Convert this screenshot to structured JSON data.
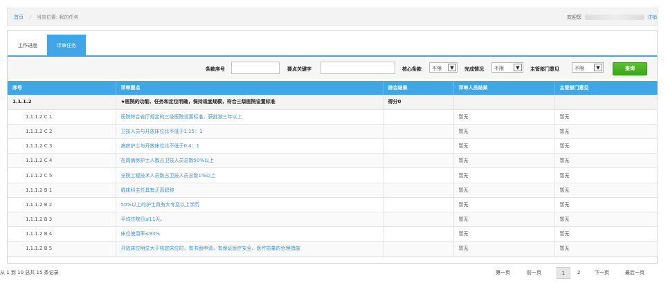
{
  "breadcrumb": {
    "home": "首页",
    "separator": "/",
    "location": "当前位置: 我的任务"
  },
  "user": {
    "welcome": "欢迎您",
    "logout": "注销"
  },
  "tabs": [
    {
      "label": "工作进度"
    },
    {
      "label": "评审任务"
    }
  ],
  "filters": {
    "item_no_label": "条款序号",
    "item_no_value": "",
    "keyword_label": "要点关键字",
    "keyword_value": "",
    "core_label": "核心条款",
    "core_value": "不限",
    "completion_label": "完成情况",
    "completion_value": "不限",
    "dept_label": "主管部门意见",
    "dept_value": "不限",
    "query_button": "查询"
  },
  "table": {
    "headers": [
      "序号",
      "评审要点",
      "综合结果",
      "评审人员结果",
      "主管部门意见"
    ],
    "group_row": {
      "code": "1.1.1.2",
      "point": "★医院的功能、任务和定位明确，保持适度规模，符合三级医院设置标准",
      "result": "得分0",
      "reviewer": "",
      "dept": ""
    },
    "rows": [
      {
        "code": "1.1.1.2 C 1",
        "point": "医院符合省厅规定的三级医院设置标准，获批准三年以上",
        "result": "",
        "reviewer": "暂无",
        "dept": "暂无"
      },
      {
        "code": "1.1.1.2 C 2",
        "point": "卫技人员与开放床位比不低于1.15：1",
        "result": "",
        "reviewer": "暂无",
        "dept": "暂无"
      },
      {
        "code": "1.1.1.2 C 3",
        "point": "病房护士与开放床位比不低于0.4：1",
        "result": "",
        "reviewer": "暂无",
        "dept": "暂无"
      },
      {
        "code": "1.1.1.2 C 4",
        "point": "在岗病房护士人数占卫技人员总数50%以上",
        "result": "",
        "reviewer": "暂无",
        "dept": "暂无"
      },
      {
        "code": "1.1.1.2 C 5",
        "point": "全院工程技术人员数占卫技人员总数1%以上",
        "result": "",
        "reviewer": "暂无",
        "dept": "暂无"
      },
      {
        "code": "1.1.1.2 B 1",
        "point": "临床科主任具有正高职称",
        "result": "",
        "reviewer": "暂无",
        "dept": "暂无"
      },
      {
        "code": "1.1.1.2 B 2",
        "point": "50%以上的护士具有大专及以上学历",
        "result": "",
        "reviewer": "暂无",
        "dept": "暂无"
      },
      {
        "code": "1.1.1.2 B 3",
        "point": "平均住院日≤11天。",
        "result": "",
        "reviewer": "暂无",
        "dept": "暂无"
      },
      {
        "code": "1.1.1.2 B 4",
        "point": "床位使用率≤93%",
        "result": "",
        "reviewer": "暂无",
        "dept": "暂无"
      },
      {
        "code": "1.1.1.2 B 5",
        "point": "开放床位明显大于核定床位时，有书面申请，有保证医疗安全、医疗质量的合理措施",
        "result": "",
        "reviewer": "暂无",
        "dept": "暂无"
      }
    ]
  },
  "footer": {
    "records": "从 1 到 10 总共 15 条记录",
    "pager": {
      "first": "第一页",
      "prev": "前一页",
      "page1": "1",
      "page2": "2",
      "next": "下一页",
      "last": "最后一页"
    }
  },
  "colors": {
    "accent": "#3fa7e6",
    "link": "#3b8fd9",
    "query_button": "#3da51a"
  }
}
